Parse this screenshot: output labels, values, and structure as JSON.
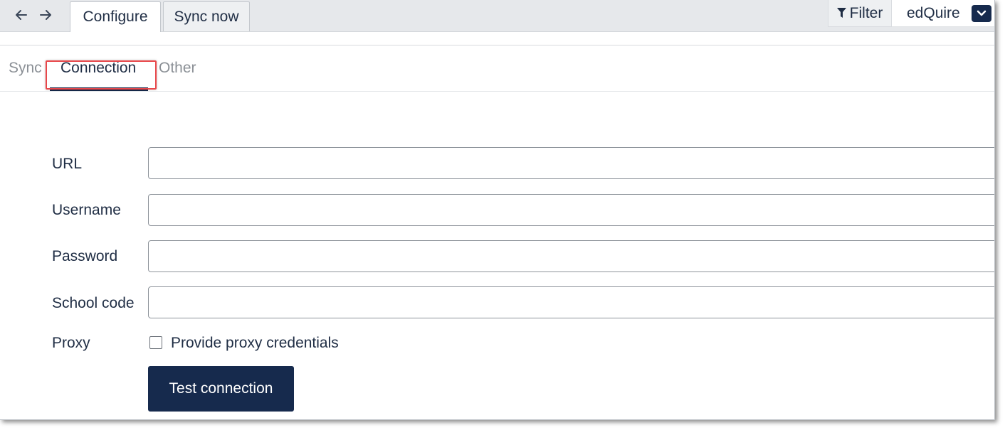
{
  "toolbar": {
    "back_icon": "arrow-left-icon",
    "forward_icon": "arrow-right-icon",
    "tabs": [
      {
        "label": "Configure",
        "active": true
      },
      {
        "label": "Sync now",
        "active": false
      }
    ],
    "filter_label": "Filter",
    "filter_icon": "funnel-icon",
    "account_name": "edQuire",
    "account_menu_icon": "chevron-down-icon"
  },
  "subtabs": [
    {
      "label": "Sync",
      "active": false
    },
    {
      "label": "Connection",
      "active": true,
      "highlighted": true
    },
    {
      "label": "Other",
      "active": false
    }
  ],
  "form": {
    "url": {
      "label": "URL",
      "value": ""
    },
    "username": {
      "label": "Username",
      "value": ""
    },
    "password": {
      "label": "Password",
      "value": ""
    },
    "school_code": {
      "label": "School code",
      "value": ""
    },
    "proxy": {
      "label": "Proxy",
      "checkbox_label": "Provide proxy credentials",
      "checked": false
    },
    "test_button_label": "Test connection"
  },
  "colors": {
    "primary": "#162a4d",
    "highlight": "#e8474a",
    "muted_text": "#8b9096"
  }
}
